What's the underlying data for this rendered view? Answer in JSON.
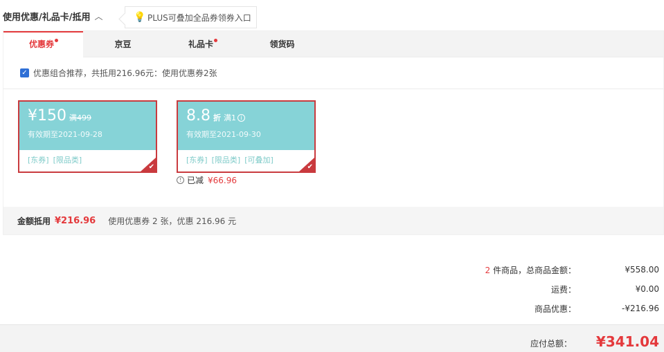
{
  "header": {
    "title": "使用优惠/礼品卡/抵用",
    "collapse_icon": "chevron-up-icon",
    "plus_tip": "PLUS可叠加全品券领券入口",
    "tip_icon": "lightbulb-icon"
  },
  "tabs": [
    {
      "label": "优惠券",
      "active": true,
      "dot": true
    },
    {
      "label": "京豆",
      "active": false,
      "dot": false
    },
    {
      "label": "礼品卡",
      "active": false,
      "dot": true
    },
    {
      "label": "领货码",
      "active": false,
      "dot": false
    }
  ],
  "combo": {
    "checked": true,
    "text": "优惠组合推荐，共抵用216.96元：使用优惠券2张"
  },
  "coupons": [
    {
      "amount": "¥150",
      "condition": "满499",
      "valid": "有效期至2021-09-28",
      "tags": [
        "[东券]",
        "[限品类]"
      ],
      "selected": true
    },
    {
      "amount": "8.8",
      "discount_unit": "折",
      "condition": "满1",
      "valid": "有效期至2021-09-30",
      "tags": [
        "[东券]",
        "[限品类]",
        "[可叠加]"
      ],
      "selected": true
    }
  ],
  "reduced": {
    "label": "已减",
    "value": "¥66.96"
  },
  "summary": {
    "label": "金额抵用",
    "amount": "¥216.96",
    "desc": "使用优惠券 2 张，优惠 216.96 元"
  },
  "totals": {
    "items_count": "2",
    "items_label": "件商品，总商品金额：",
    "items_value": "¥558.00",
    "shipping_label": "运费：",
    "shipping_value": "¥0.00",
    "discount_label": "商品优惠：",
    "discount_value": "-¥216.96"
  },
  "pay": {
    "label": "应付总额：",
    "value": "¥341.04"
  },
  "colors": {
    "accent": "#e4393c",
    "coupon_bg": "#86d3d7",
    "coupon_border": "#c93a3e"
  }
}
